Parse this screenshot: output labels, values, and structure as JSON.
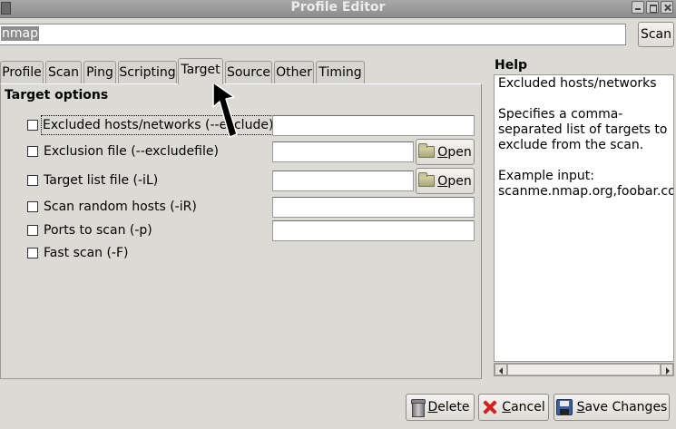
{
  "window": {
    "title": "Profile Editor"
  },
  "profile_name": "nmap",
  "scan_button": "Scan",
  "tabs": [
    {
      "label": "Profile"
    },
    {
      "label": "Scan"
    },
    {
      "label": "Ping"
    },
    {
      "label": "Scripting"
    },
    {
      "label": "Target",
      "active": true
    },
    {
      "label": "Source"
    },
    {
      "label": "Other"
    },
    {
      "label": "Timing"
    }
  ],
  "target": {
    "section_title": "Target options",
    "options": [
      {
        "label": "Excluded hosts/networks (--exclude)",
        "checked": false,
        "value": ""
      },
      {
        "label": "Exclusion file (--excludefile)",
        "checked": false,
        "value": ""
      },
      {
        "label": "Target list file (-iL)",
        "checked": false,
        "value": ""
      },
      {
        "label": "Scan random hosts (-iR)",
        "checked": false,
        "value": ""
      },
      {
        "label": "Ports to scan (-p)",
        "checked": false,
        "value": ""
      },
      {
        "label": "Fast scan (-F)",
        "checked": false
      }
    ],
    "open_button_prefix": "",
    "open_button_mnemonic": "O",
    "open_button_rest": "pen"
  },
  "help": {
    "title": "Help",
    "heading": "Excluded hosts/networks",
    "description_lines": [
      "Specifies a comma-",
      "separated list of targets to",
      "exclude from the scan."
    ],
    "example_label": "Example input:",
    "example_value": "scanme.nmap.org,foobar.com"
  },
  "buttons": {
    "delete_mnemonic": "D",
    "delete_rest": "elete",
    "cancel_mnemonic": "C",
    "cancel_rest": "ancel",
    "save_mnemonic": "S",
    "save_rest": "ave Changes"
  },
  "colors": {
    "window_bg": "#dcdad5",
    "entry_bg": "#ffffff",
    "selection": "#8e8e8e"
  }
}
